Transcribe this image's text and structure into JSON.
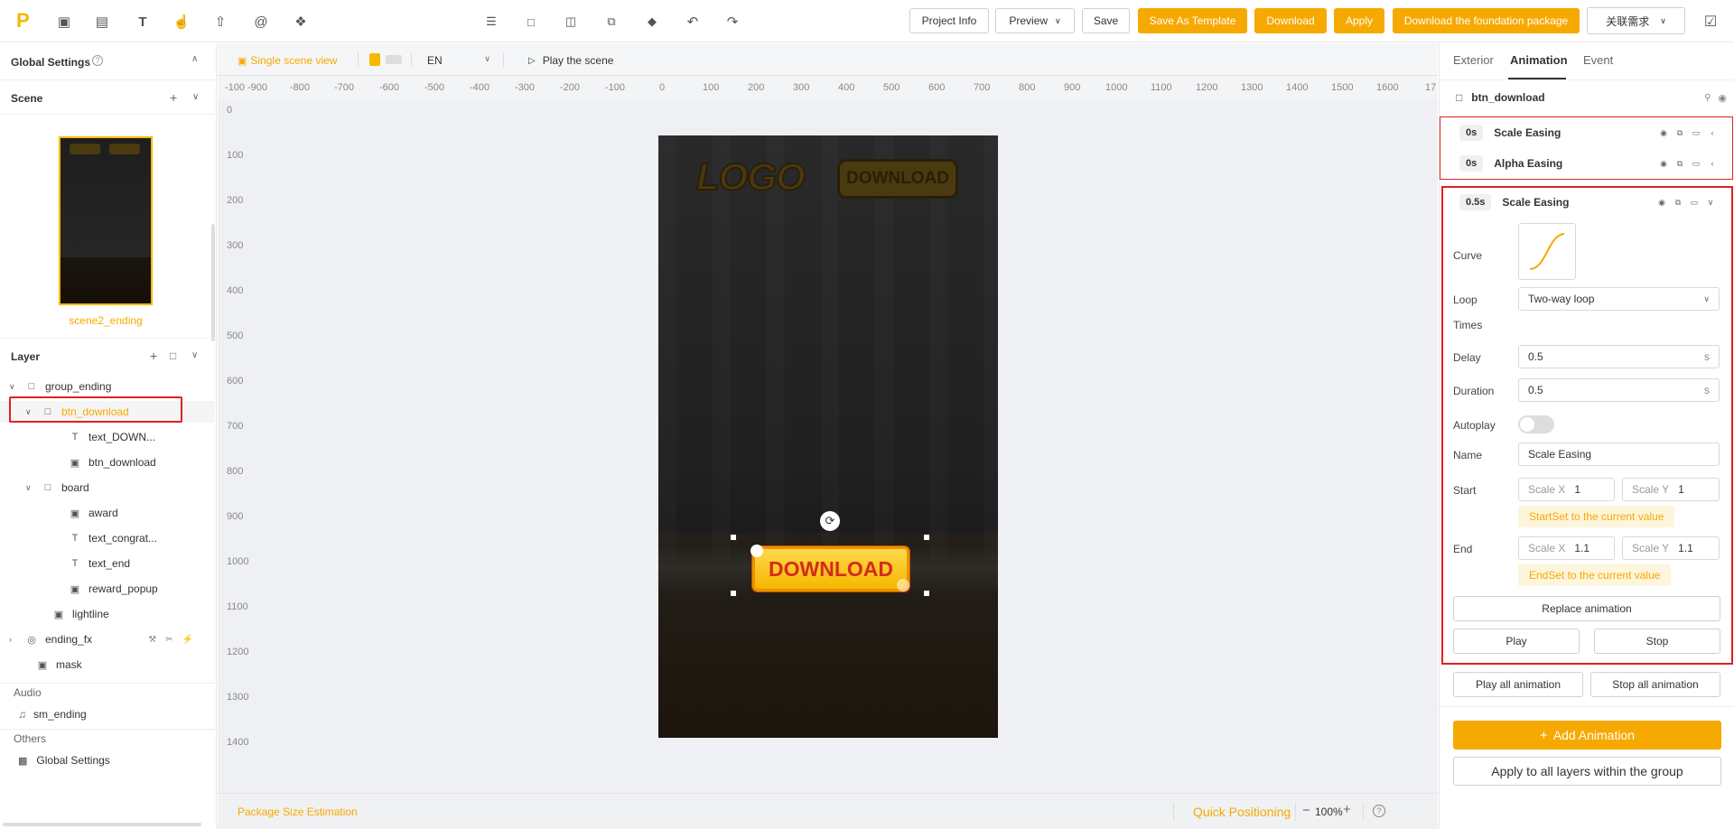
{
  "topbar": {
    "logo": "P",
    "tools": [
      "inbox-icon",
      "list-icon",
      "text-tool-icon",
      "touch-icon",
      "upload-file-icon",
      "at-icon",
      "puzzle-icon"
    ],
    "center_tools": [
      "layers-icon",
      "folder-icon",
      "open-folder-icon",
      "copy-icon",
      "eraser-icon",
      "undo-icon",
      "redo-icon"
    ],
    "project_info": "Project Info",
    "preview": "Preview",
    "save": "Save",
    "save_as_template": "Save As Template",
    "download": "Download",
    "apply": "Apply",
    "download_foundation": "Download the foundation package",
    "related_demand": "关联需求"
  },
  "left": {
    "global_settings": "Global Settings",
    "scene_title": "Scene",
    "scene_name": "scene2_ending",
    "layer_title": "Layer",
    "layers": [
      {
        "label": "group_ending",
        "type": "folder",
        "indent": 0
      },
      {
        "label": "btn_download",
        "type": "folder",
        "indent": 1
      },
      {
        "label": "text_DOWN...",
        "type": "text",
        "indent": 2
      },
      {
        "label": "btn_download",
        "type": "image",
        "indent": 2
      },
      {
        "label": "board",
        "type": "folder",
        "indent": 1
      },
      {
        "label": "award",
        "type": "image",
        "indent": 2
      },
      {
        "label": "text_congrat...",
        "type": "text",
        "indent": 2
      },
      {
        "label": "text_end",
        "type": "text",
        "indent": 2
      },
      {
        "label": "reward_popup",
        "type": "image",
        "indent": 2
      },
      {
        "label": "lightline",
        "type": "image",
        "indent": 1
      },
      {
        "label": "ending_fx",
        "type": "fx",
        "indent": 0
      },
      {
        "label": "mask",
        "type": "image",
        "indent": 0
      }
    ],
    "audio_title": "Audio",
    "audio_item": "sm_ending",
    "others_title": "Others",
    "others_item": "Global Settings"
  },
  "canvas": {
    "single_scene_view": "Single scene view",
    "language": "EN",
    "play_scene": "Play the scene",
    "ruler_x": [
      "-100",
      "-900",
      "-800",
      "-700",
      "-600",
      "-500",
      "-400",
      "-300",
      "-200",
      "-100",
      "0",
      "100",
      "200",
      "300",
      "400",
      "500",
      "600",
      "700",
      "800",
      "900",
      "1000",
      "1100",
      "1200",
      "1300",
      "1400",
      "1500",
      "1600",
      "17"
    ],
    "ruler_y": [
      "0",
      "100",
      "200",
      "300",
      "400",
      "500",
      "600",
      "700",
      "800",
      "900",
      "1000",
      "1100",
      "1200",
      "1300",
      "1400"
    ],
    "logo_text": "LOGO",
    "top_button_text": "DOWNLOAD",
    "main_button_text": "DOWNLOAD",
    "package_size": "Package Size Estimation",
    "quick_positioning": "Quick Positioning",
    "zoom": "100%"
  },
  "right": {
    "tabs": [
      "Exterior",
      "Animation",
      "Event"
    ],
    "active_tab": "Animation",
    "layer_name": "btn_download",
    "animations": [
      {
        "time": "0s",
        "name": "Scale Easing"
      },
      {
        "time": "0s",
        "name": "Alpha Easing"
      }
    ],
    "expanded": {
      "time": "0.5s",
      "name": "Scale Easing",
      "curve_label": "Curve",
      "loop_label": "Loop",
      "loop_value": "Two-way loop",
      "times_label": "Times",
      "delay_label": "Delay",
      "delay_value": "0.5",
      "duration_label": "Duration",
      "duration_value": "0.5",
      "unit": "s",
      "autoplay_label": "Autoplay",
      "autoplay_on": false,
      "name_label": "Name",
      "name_value": "Scale Easing",
      "start_label": "Start",
      "start_x_label": "Scale X",
      "start_x": "1",
      "start_y_label": "Scale Y",
      "start_y": "1",
      "start_set": "StartSet to the current value",
      "end_label": "End",
      "end_x_label": "Scale X",
      "end_x": "1.1",
      "end_y_label": "Scale Y",
      "end_y": "1.1",
      "end_set": "EndSet to the current value",
      "replace": "Replace animation",
      "play": "Play",
      "stop": "Stop"
    },
    "play_all": "Play all animation",
    "stop_all": "Stop all animation",
    "add_animation": "Add Animation",
    "apply_group": "Apply to all layers within the group"
  },
  "colors": {
    "accent": "#f6a900",
    "highlight": "#e02020"
  }
}
